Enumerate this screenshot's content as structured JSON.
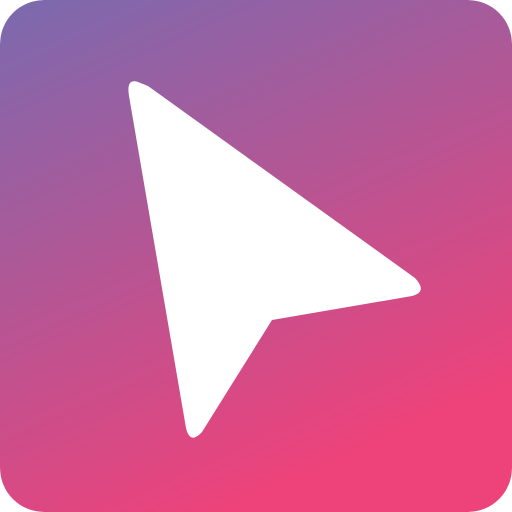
{
  "icon": {
    "name": "cursor-arrow-icon",
    "gradient_start": "#7a6aaf",
    "gradient_end": "#ee427a",
    "glyph_color": "#ffffff"
  }
}
